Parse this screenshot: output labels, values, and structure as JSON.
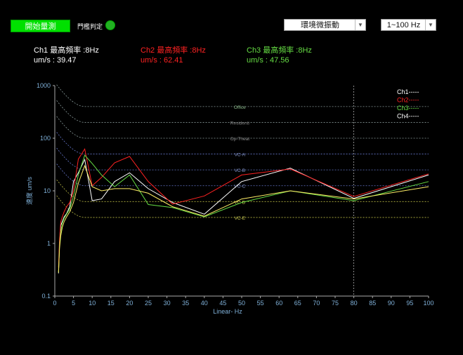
{
  "controls": {
    "start_label": "開始量測",
    "threshold_label": "門檻判定",
    "mode_value": "環境微振動",
    "range_value": "1~100 Hz",
    "colors": {
      "start_bg": "#00e000",
      "led": "#22b022"
    }
  },
  "readouts": [
    {
      "title": "Ch1 最高頻率 :8Hz",
      "value": "um/s : 39.47",
      "color": "#ffffff"
    },
    {
      "title": "Ch2 最高頻率 :8Hz",
      "value": "um/s : 62.41",
      "color": "#ff2222"
    },
    {
      "title": "Ch3 最高頻率 :8Hz",
      "value": "um/s : 47.56",
      "color": "#66dd44"
    }
  ],
  "chart_data": {
    "type": "line",
    "xlabel": "Linear- Hz",
    "ylabel": "速度 um/s",
    "xlim": [
      0,
      100
    ],
    "ylim": [
      0.1,
      1000
    ],
    "yscale": "log",
    "x_ticks": [
      0,
      5,
      10,
      15,
      20,
      25,
      30,
      35,
      40,
      45,
      50,
      55,
      60,
      65,
      70,
      75,
      80,
      85,
      90,
      95,
      100
    ],
    "y_ticks": [
      {
        "value": 0.1,
        "label": "0.1"
      },
      {
        "value": 1,
        "label": "1"
      },
      {
        "value": 10,
        "label": "10"
      },
      {
        "value": 100,
        "label": "100"
      },
      {
        "value": 1000,
        "label": "1000"
      }
    ],
    "marker_x": 80,
    "criteria": [
      {
        "label": "Office",
        "value": 400,
        "color": "#889999",
        "labelColor": "#8fbf8f"
      },
      {
        "label": "Residenti",
        "value": 200,
        "color": "#889999",
        "labelColor": "#888888"
      },
      {
        "label": "Op-Theat",
        "value": 100,
        "color": "#889999",
        "labelColor": "#888888"
      },
      {
        "label": "VC-A",
        "value": 50,
        "color": "#6677cc",
        "labelColor": "#8899cc"
      },
      {
        "label": "VC-B",
        "value": 25,
        "color": "#6677cc",
        "labelColor": "#8899cc"
      },
      {
        "label": "VC-C",
        "value": 12.5,
        "color": "#6677cc",
        "labelColor": "#8899cc"
      },
      {
        "label": "VC-D",
        "value": 6.25,
        "color": "#bbbb44",
        "labelColor": "#cccc55"
      },
      {
        "label": "VC-E",
        "value": 3.12,
        "color": "#bbbb44",
        "labelColor": "#cccc55"
      }
    ],
    "legend": [
      {
        "label": "Ch1-----",
        "color": "#ffffff"
      },
      {
        "label": "Ch2-----",
        "color": "#ff2222"
      },
      {
        "label": "Ch3-----",
        "color": "#66dd44"
      },
      {
        "label": "Ch4-----",
        "color": "#ffffff"
      }
    ],
    "series": [
      {
        "name": "Ch1",
        "color": "#ffffff",
        "x": [
          1,
          1.25,
          1.6,
          2,
          2.5,
          3.15,
          4,
          5,
          6.3,
          8,
          10,
          12.5,
          16,
          20,
          25,
          31.5,
          40,
          50,
          63,
          80,
          100
        ],
        "y": [
          0.27,
          1,
          2.2,
          2.6,
          3.2,
          3.7,
          5,
          15,
          22,
          39.47,
          6.5,
          7,
          15,
          22,
          11,
          6,
          3.6,
          15,
          27,
          7.2,
          20
        ]
      },
      {
        "name": "Ch2",
        "color": "#ff2222",
        "x": [
          1,
          1.25,
          1.6,
          2,
          2.5,
          3.15,
          4,
          5,
          6.3,
          8,
          10,
          12.5,
          16,
          20,
          25,
          31.5,
          40,
          50,
          63,
          80,
          100
        ],
        "y": [
          0.35,
          1.2,
          2.6,
          3.2,
          4,
          5,
          6,
          10,
          40,
          62.41,
          12.5,
          18,
          34,
          45,
          15,
          5.6,
          8,
          20,
          26,
          7.8,
          21
        ]
      },
      {
        "name": "Ch3",
        "color": "#66dd44",
        "x": [
          1,
          1.25,
          1.6,
          2,
          2.5,
          3.15,
          4,
          5,
          6.3,
          8,
          10,
          12.5,
          16,
          20,
          25,
          31.5,
          40,
          50,
          63,
          80,
          100
        ],
        "y": [
          0.28,
          0.9,
          1.7,
          2.4,
          3,
          3.6,
          4.5,
          8,
          20,
          47.56,
          33,
          20,
          12,
          20,
          5.5,
          4.8,
          3.2,
          6,
          10,
          6.5,
          15
        ]
      },
      {
        "name": "Ch4",
        "color": "#ffee66",
        "x": [
          1,
          1.25,
          1.6,
          2,
          2.5,
          3.15,
          4,
          5,
          6.3,
          8,
          10,
          12.5,
          16,
          20,
          25,
          31.5,
          40,
          50,
          63,
          80,
          100
        ],
        "y": [
          0.28,
          0.8,
          1.4,
          2,
          2.6,
          3.2,
          4,
          6,
          14,
          30,
          12,
          10,
          11,
          11,
          9,
          5,
          3.3,
          7,
          10,
          7,
          12
        ]
      }
    ]
  }
}
